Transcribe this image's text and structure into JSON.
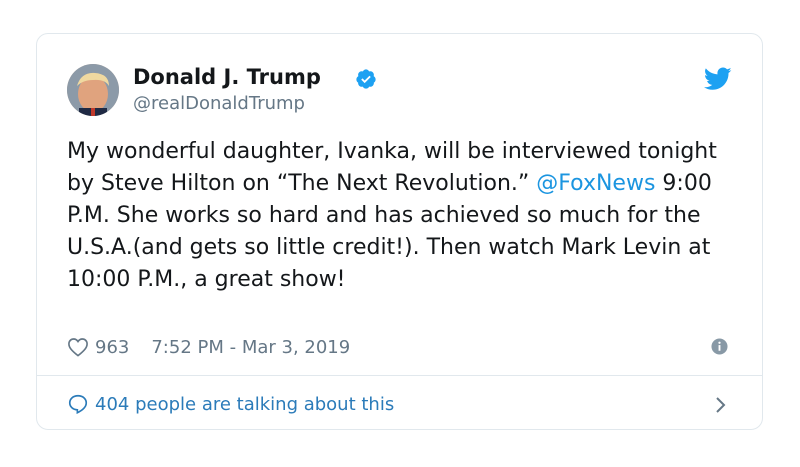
{
  "tweet": {
    "author_name": "Donald J. Trump",
    "handle": "@realDonaldTrump",
    "text_part1": "My wonderful daughter, Ivanka, will be interviewed tonight by Steve Hilton on “The Next Revolution.” ",
    "mention": "@FoxNews",
    "text_part2": " 9:00 P.M. She works so hard and has achieved so much for the U.S.A.(and gets so little credit!). Then watch Mark Levin at 10:00 P.M., a great show!",
    "like_count": "963",
    "timestamp": "7:52 PM - Mar 3, 2019",
    "talking_text": "404 people are talking about this"
  },
  "icons": {
    "verified": "verified-badge-icon",
    "logo": "twitter-bird-icon",
    "like": "heart-icon",
    "info": "info-icon",
    "reply": "speech-bubble-icon",
    "chevron": "chevron-right-icon"
  },
  "colors": {
    "accent": "#1da1f2",
    "link": "#1b95e0",
    "muted": "#657786",
    "border": "#e1e8ed"
  }
}
